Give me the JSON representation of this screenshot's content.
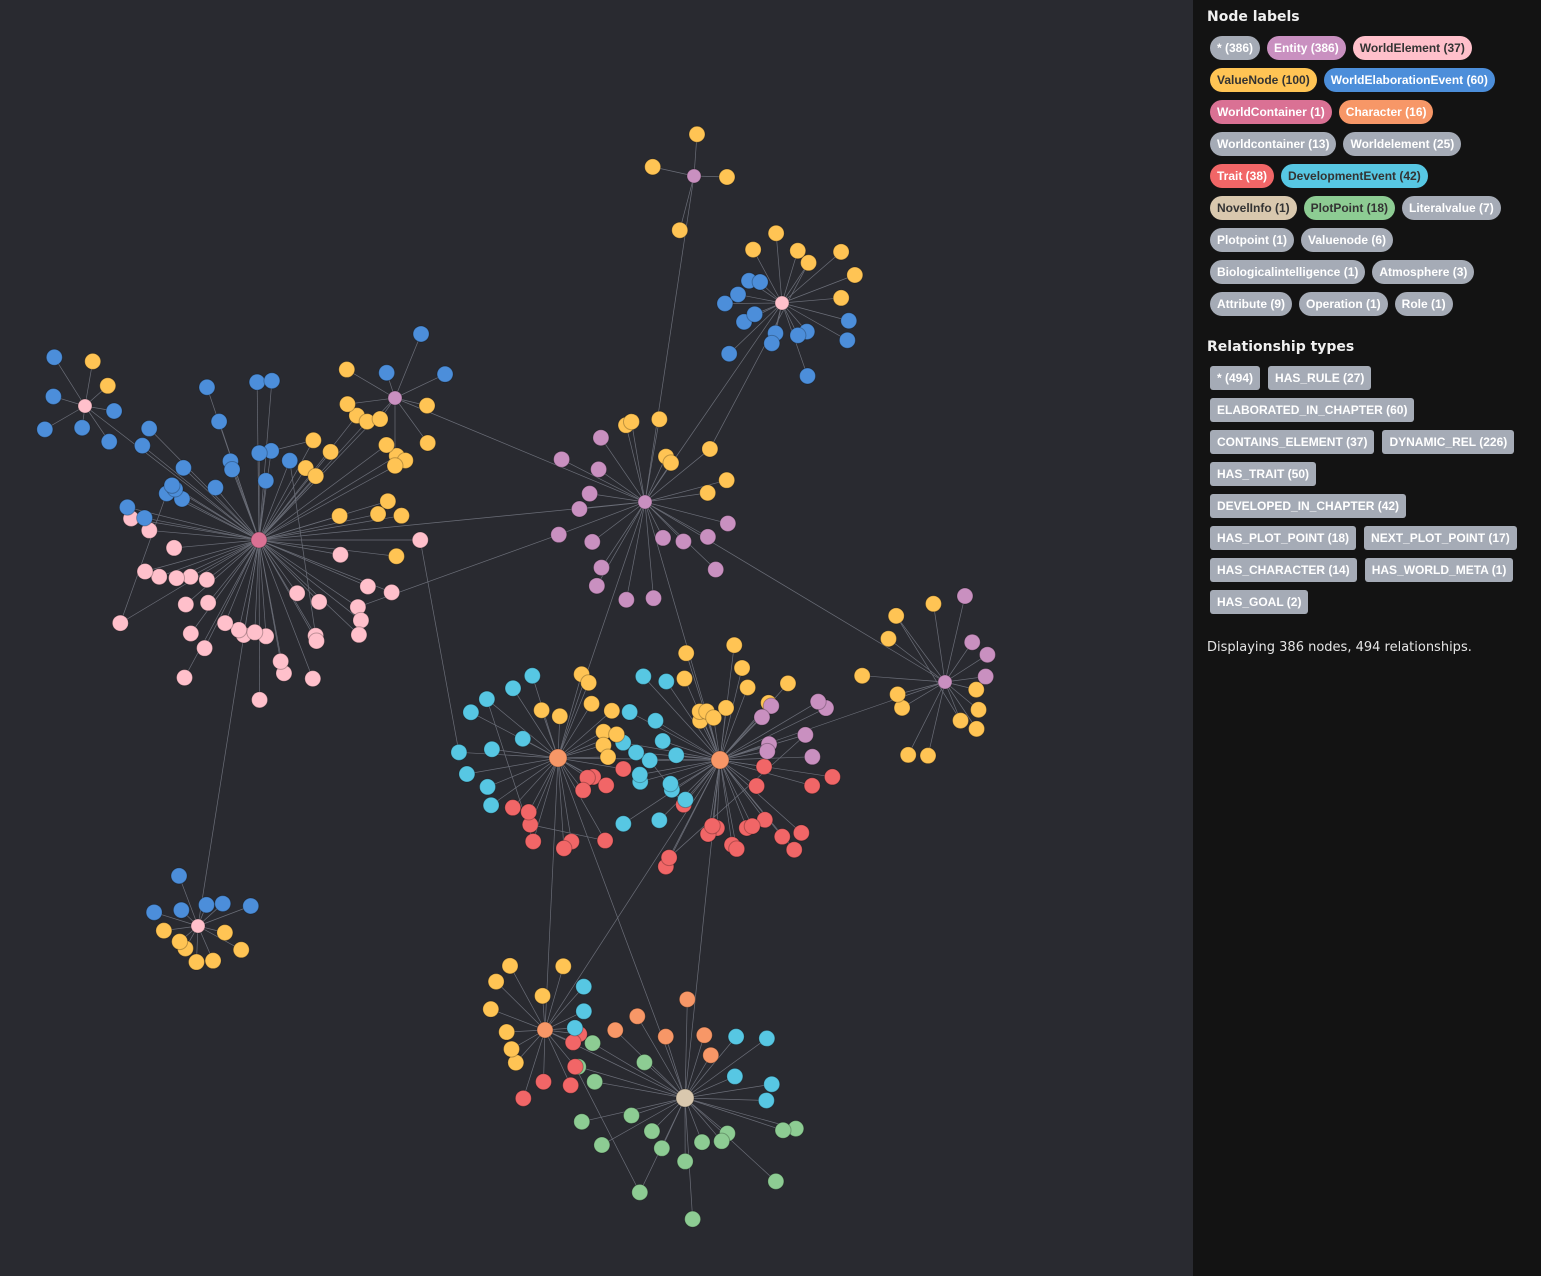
{
  "panel": {
    "node_labels_title": "Node labels",
    "relationship_types_title": "Relationship types",
    "status": "Displaying 386 nodes, 494 relationships.",
    "node_labels": [
      {
        "label": "* (386)",
        "bg": "#a5abb6",
        "fg": "#ffffff"
      },
      {
        "label": "Entity (386)",
        "bg": "#c990c0",
        "fg": "#ffffff"
      },
      {
        "label": "WorldElement (37)",
        "bg": "#ffc0cb",
        "fg": "#333333"
      },
      {
        "label": "ValueNode (100)",
        "bg": "#ffc454",
        "fg": "#333333"
      },
      {
        "label": "WorldElaborationEvent (60)",
        "bg": "#4c8eda",
        "fg": "#ffffff"
      },
      {
        "label": "WorldContainer (1)",
        "bg": "#da7194",
        "fg": "#ffffff"
      },
      {
        "label": "Character (16)",
        "bg": "#f79767",
        "fg": "#ffffff"
      },
      {
        "label": "Worldcontainer (13)",
        "bg": "#a5abb6",
        "fg": "#ffffff"
      },
      {
        "label": "Worldelement (25)",
        "bg": "#a5abb6",
        "fg": "#ffffff"
      },
      {
        "label": "Trait (38)",
        "bg": "#f16667",
        "fg": "#ffffff"
      },
      {
        "label": "DevelopmentEvent (42)",
        "bg": "#57c7e3",
        "fg": "#333333"
      },
      {
        "label": "NovelInfo (1)",
        "bg": "#d9c8ae",
        "fg": "#333333"
      },
      {
        "label": "PlotPoint (18)",
        "bg": "#8dcc93",
        "fg": "#333333"
      },
      {
        "label": "Literalvalue (7)",
        "bg": "#a5abb6",
        "fg": "#ffffff"
      },
      {
        "label": "Plotpoint (1)",
        "bg": "#a5abb6",
        "fg": "#ffffff"
      },
      {
        "label": "Valuenode (6)",
        "bg": "#a5abb6",
        "fg": "#ffffff"
      },
      {
        "label": "Biologicalintelligence (1)",
        "bg": "#a5abb6",
        "fg": "#ffffff"
      },
      {
        "label": "Atmosphere (3)",
        "bg": "#a5abb6",
        "fg": "#ffffff"
      },
      {
        "label": "Attribute (9)",
        "bg": "#a5abb6",
        "fg": "#ffffff"
      },
      {
        "label": "Operation (1)",
        "bg": "#a5abb6",
        "fg": "#ffffff"
      },
      {
        "label": "Role (1)",
        "bg": "#a5abb6",
        "fg": "#ffffff"
      }
    ],
    "relationship_types": [
      "* (494)",
      "HAS_RULE (27)",
      "ELABORATED_IN_CHAPTER (60)",
      "CONTAINS_ELEMENT (37)",
      "DYNAMIC_REL (226)",
      "HAS_TRAIT (50)",
      "DEVELOPED_IN_CHAPTER (42)",
      "HAS_PLOT_POINT (18)",
      "NEXT_PLOT_POINT (17)",
      "HAS_CHARACTER (14)",
      "HAS_WORLD_META (1)",
      "HAS_GOAL (2)"
    ]
  },
  "graph": {
    "colors": {
      "background": "#292a30",
      "edge": "#6b6e78",
      "Entity": "#c990c0",
      "WorldElement": "#ffc0cb",
      "ValueNode": "#ffc454",
      "WorldElaborationEvent": "#4c8eda",
      "WorldContainer": "#da7194",
      "Character": "#f79767",
      "Trait": "#f16667",
      "DevelopmentEvent": "#57c7e3",
      "NovelInfo": "#d9c8ae",
      "PlotPoint": "#8dcc93"
    }
  }
}
